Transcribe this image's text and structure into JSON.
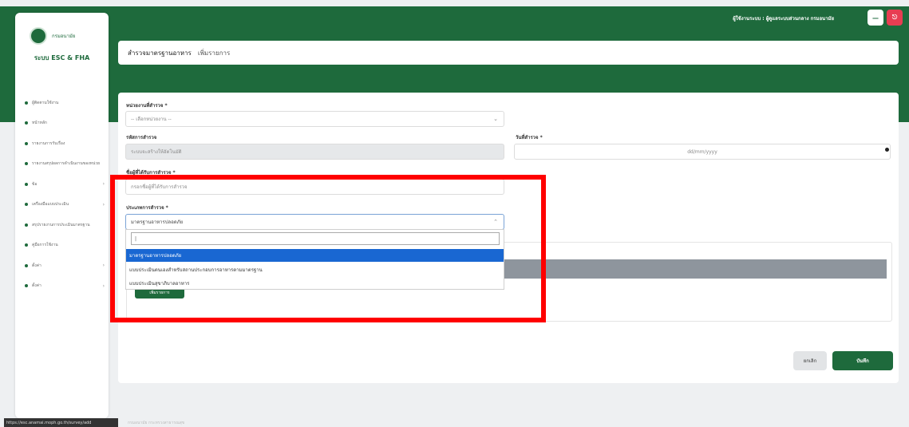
{
  "app": {
    "brand_title": "ระบบ ESC & FHA",
    "logo_text": "กรมอนามัย"
  },
  "sidebar": {
    "items": [
      {
        "label": "ผู้ติดตามใช้งาน",
        "icon": "dot-icon",
        "chevron": ""
      },
      {
        "label": "หน้าหลัก",
        "icon": "dot-icon",
        "chevron": ""
      },
      {
        "label": "รายงานการรับเรื่อง",
        "icon": "dot-icon",
        "chevron": ""
      },
      {
        "label": "รายงานสรุปผลการดำเนินงานของหน่วย",
        "icon": "dot-icon",
        "chevron": ""
      },
      {
        "label": "ข้อ",
        "icon": "dot-icon",
        "chevron": "›"
      },
      {
        "label": "เครื่องมือแบบประเมิน",
        "icon": "dot-icon",
        "chevron": "›"
      },
      {
        "label": "สรุปรายงานการประเมินมาตรฐาน",
        "icon": "dot-icon",
        "chevron": ""
      },
      {
        "label": "คู่มือการใช้งาน",
        "icon": "dot-icon",
        "chevron": ""
      },
      {
        "label": "ตั้งค่า",
        "icon": "dot-icon",
        "chevron": "›"
      },
      {
        "label": "ตั้งค่า",
        "icon": "dot-icon",
        "chevron": "›"
      }
    ]
  },
  "topbar": {
    "user_text": "ผู้ใช้งานระบบ : ผู้ดูแลระบบส่วนกลาง กรมอนามัย",
    "minimize_label": "—",
    "logout_label": "⎋"
  },
  "breadcrumb": {
    "section": "สำรวจมาตรฐานอาหาร",
    "current": "เพิ่มรายการ"
  },
  "form": {
    "unit_label": "หน่วยงานที่สำรวจ *",
    "unit_value": "-- เลือกหน่วยงาน --",
    "code_label": "รหัสการสำรวจ",
    "code_value": "ระบบจะสร้างให้อัตโนมัติ",
    "date_label": "วันที่สำรวจ *",
    "date_value": "dd/mm/yyyy",
    "name_label": "ชื่อผู้ที่ได้รับการสำรวจ *",
    "name_placeholder": "กรอกชื่อผู้ที่ได้รับการสำรวจ",
    "type_label": "ประเภทการสำรวจ *",
    "type_value": "มาตรฐานอาหารปลอดภัย",
    "type_search": "|",
    "type_options": [
      "มาตรฐานอาหารปลอดภัย",
      "แบบประเมินตนเองสำหรับสถานประกอบการอาหารตามมาตรฐาน",
      "แบบประเมินสุขาภิบาลอาหาร"
    ],
    "add_button": "เพิ่มรายการ"
  },
  "actions": {
    "cancel": "ยกเลิก",
    "save": "บันทึก"
  },
  "status": {
    "url": "https://esc.anamai.moph.go.th/survey/add",
    "footer": "กรมอนามัย กระทรวงสาธารณสุข"
  },
  "colors": {
    "primary": "#1e6a3c",
    "danger": "#e83d52",
    "highlight": "#ff0000",
    "selected": "#1967d2"
  }
}
